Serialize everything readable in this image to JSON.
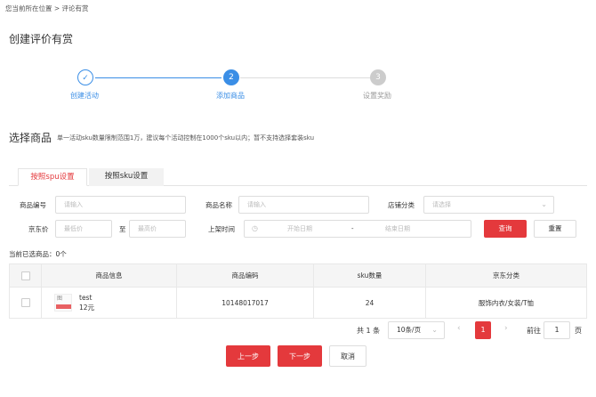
{
  "breadcrumb": "您当前所在位置 > 评论有赏",
  "page_title": "创建评价有赏",
  "steps": [
    {
      "label": "创建活动",
      "number": "✓"
    },
    {
      "label": "添加商品",
      "number": "2"
    },
    {
      "label": "设置奖励",
      "number": "3"
    }
  ],
  "section": {
    "title": "选择商品",
    "hint": "单一活动sku数量限制范围1万，建议每个活动控制在1000个sku以内；暂不支持选择套装sku"
  },
  "tabs": {
    "spu": "按照spu设置",
    "sku": "按照sku设置"
  },
  "filters": {
    "product_code_label": "商品编号",
    "product_code_placeholder": "请输入",
    "product_name_label": "商品名称",
    "product_name_placeholder": "请输入",
    "shop_category_label": "店铺分类",
    "shop_category_placeholder": "请选择",
    "jd_price_label": "京东价",
    "min_price_placeholder": "最低价",
    "to_label": "至",
    "max_price_placeholder": "最高价",
    "listing_time_label": "上架时间",
    "start_date_placeholder": "开始日期",
    "date_sep": "-",
    "end_date_placeholder": "结束日期",
    "query_button": "查询",
    "reset_button": "重置"
  },
  "selected_count": "当前已选商品：0个",
  "table": {
    "headers": [
      "商品信息",
      "商品编码",
      "sku数量",
      "京东分类"
    ],
    "rows": [
      {
        "name": "test",
        "price": "12元",
        "thumb_text": "图",
        "code": "10148017017",
        "sku_count": "24",
        "category": "服饰内衣/女装/T恤"
      }
    ]
  },
  "pagination": {
    "total": "共 1 条",
    "page_size": "10条/页",
    "prev": "‹",
    "current_page": "1",
    "next": "›",
    "goto_label": "前往",
    "goto_value": "1",
    "goto_unit": "页"
  },
  "actions": {
    "prev": "上一步",
    "next": "下一步",
    "cancel": "取消"
  },
  "colors": {
    "accent_red": "#e4393c",
    "step_active_blue": "#3a8ee6",
    "step_inactive_gray": "#cccccc"
  }
}
